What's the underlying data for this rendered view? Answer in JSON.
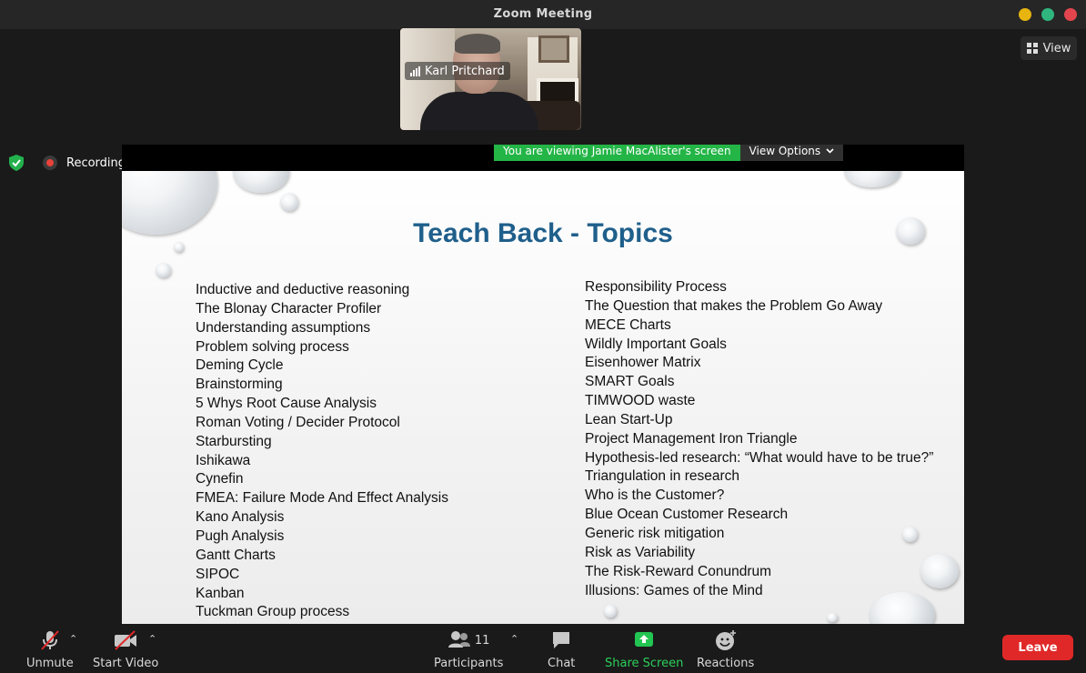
{
  "window": {
    "title": "Zoom Meeting"
  },
  "view_button": {
    "label": "View",
    "icon": "grid-icon"
  },
  "video_thumb": {
    "participant_name": "Karl Pritchard"
  },
  "status": {
    "recording_label": "Recording"
  },
  "share": {
    "banner_text": "You are viewing Jamie MacAlister's screen",
    "view_options_label": "View Options"
  },
  "slide": {
    "title": "Teach Back - Topics",
    "left_topics": [
      "Inductive and deductive reasoning",
      "The Blonay Character Profiler",
      "Understanding assumptions",
      "Problem solving process",
      "Deming Cycle",
      "Brainstorming",
      "5 Whys Root Cause Analysis",
      "Roman Voting / Decider Protocol",
      "Starbursting",
      "Ishikawa",
      "Cynefin",
      "FMEA: Failure Mode And Effect Analysis",
      "Kano Analysis",
      "Pugh Analysis",
      "Gantt Charts",
      "SIPOC",
      "Kanban",
      "Tuckman Group process"
    ],
    "right_topics": [
      "Responsibility Process",
      "The Question that makes the Problem Go Away",
      "MECE Charts",
      "Wildly Important Goals",
      "Eisenhower Matrix",
      "SMART Goals",
      "TIMWOOD waste",
      "Lean Start-Up",
      "Project Management Iron Triangle",
      "Hypothesis-led research: “What would have to be true?”",
      "Triangulation in research",
      "Who is the Customer?",
      "Blue Ocean Customer Research",
      "Generic risk mitigation",
      "Risk as Variability",
      "The Risk-Reward Conundrum",
      "Illusions: Games of the Mind"
    ]
  },
  "toolbar": {
    "unmute": "Unmute",
    "start_video": "Start Video",
    "participants": "Participants",
    "participants_count": "11",
    "chat": "Chat",
    "share_screen": "Share Screen",
    "reactions": "Reactions",
    "leave": "Leave"
  },
  "colors": {
    "share_green": "#24b547",
    "leave_red": "#e02828",
    "slide_title_blue": "#1f5f8b"
  }
}
